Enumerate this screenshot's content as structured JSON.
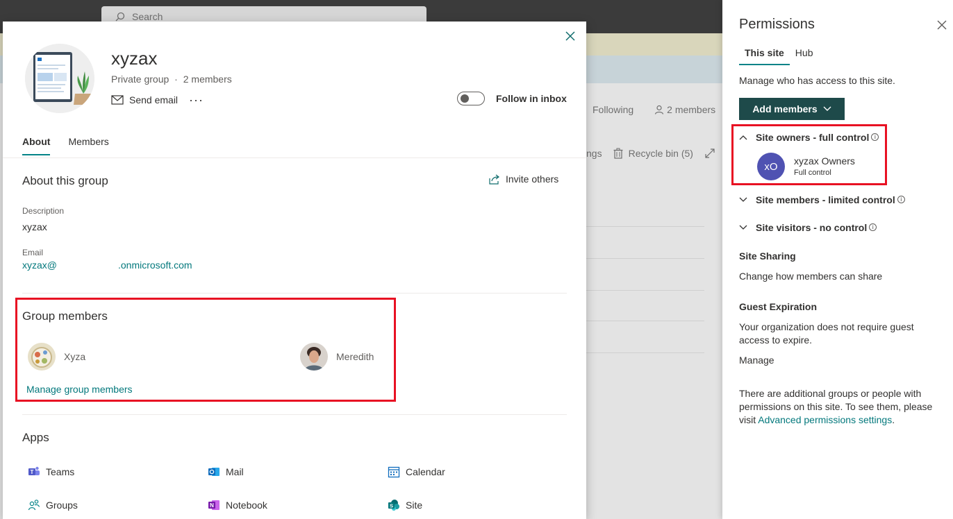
{
  "background": {
    "search_placeholder": "Search",
    "following": "Following",
    "members": "2 members",
    "cmd_settings": "ngs",
    "recycle_bin": "Recycle bin (5)"
  },
  "card": {
    "title": "xyzax",
    "subtitle": "Private group",
    "separator": "·",
    "member_count": "2 members",
    "send_email": "Send email",
    "more": "···",
    "follow_label": "Follow in inbox",
    "tabs": [
      {
        "label": "About",
        "active": true
      },
      {
        "label": "Members",
        "active": false
      }
    ],
    "about": {
      "heading": "About this group",
      "invite": "Invite others",
      "description_label": "Description",
      "description_value": "xyzax",
      "email_label": "Email",
      "email_prefix": "xyzax@",
      "email_suffix": ".onmicrosoft.com"
    },
    "group_members": {
      "heading": "Group members",
      "members": [
        {
          "name": "Xyza"
        },
        {
          "name": "Meredith"
        }
      ],
      "manage": "Manage group members"
    },
    "apps": {
      "heading": "Apps",
      "items": [
        {
          "label": "Teams",
          "icon": "teams-icon",
          "color": "#5059c9"
        },
        {
          "label": "Mail",
          "icon": "outlook-icon",
          "color": "#0f6cbd"
        },
        {
          "label": "Calendar",
          "icon": "calendar-icon",
          "color": "#0f6cbd"
        },
        {
          "label": "Groups",
          "icon": "groups-icon",
          "color": "#038387"
        },
        {
          "label": "Notebook",
          "icon": "onenote-icon",
          "color": "#7719aa"
        },
        {
          "label": "Site",
          "icon": "sharepoint-icon",
          "color": "#038387"
        }
      ]
    }
  },
  "permissions": {
    "title": "Permissions",
    "tabs": [
      {
        "label": "This site",
        "active": true
      },
      {
        "label": "Hub",
        "active": false
      }
    ],
    "intro": "Manage who has access to this site.",
    "add_members": "Add members",
    "groups": {
      "owners": "Site owners - full control",
      "members": "Site members - limited control",
      "visitors": "Site visitors - no control"
    },
    "owner_entry": {
      "initials": "xO",
      "name": "xyzax Owners",
      "role": "Full control"
    },
    "sharing": {
      "heading": "Site Sharing",
      "link": "Change how members can share"
    },
    "guest": {
      "heading": "Guest Expiration",
      "text_line1": "Your organization does not require guest",
      "text_line2": "access to expire.",
      "link": "Manage"
    },
    "additional": {
      "line1": "There are additional groups or people with",
      "line2": "permissions on this site. To see them, please",
      "line3_prefix": "visit ",
      "link": "Advanced permissions settings",
      "line3_suffix": "."
    }
  },
  "colors": {
    "accent": "#038387",
    "button_bg": "#1e4a4a",
    "highlight_red": "#e81123",
    "owner_avatar": "#4f52b2"
  }
}
